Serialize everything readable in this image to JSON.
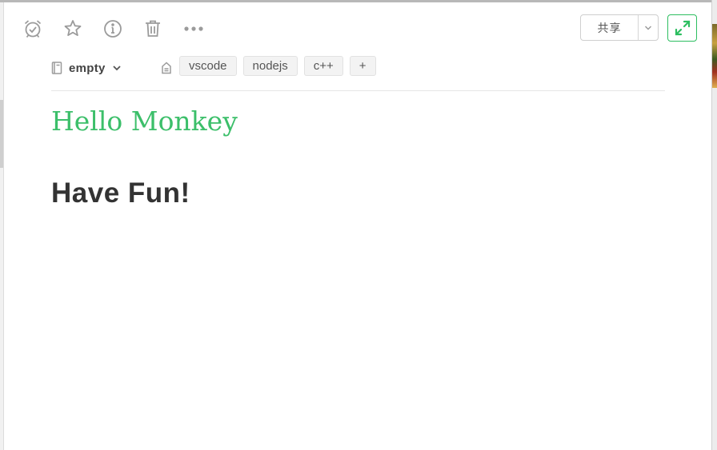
{
  "toolbar": {
    "reminder_icon": "alarm-check-icon",
    "shortcut_icon": "star-icon",
    "info_icon": "info-icon",
    "delete_icon": "trash-icon",
    "more_icon": "more-horizontal-icon",
    "share_label": "共享",
    "expand_icon": "expand-icon"
  },
  "meta": {
    "notebook": "empty",
    "tags": [
      "vscode",
      "nodejs",
      "c++"
    ],
    "add_tag_label": "+"
  },
  "note": {
    "title": "Hello Monkey",
    "body": "Have Fun!"
  },
  "colors": {
    "accent": "#2dbe60",
    "title": "#3cbf6a",
    "icon_gray": "#9b9b9b",
    "body_text": "#333333"
  }
}
